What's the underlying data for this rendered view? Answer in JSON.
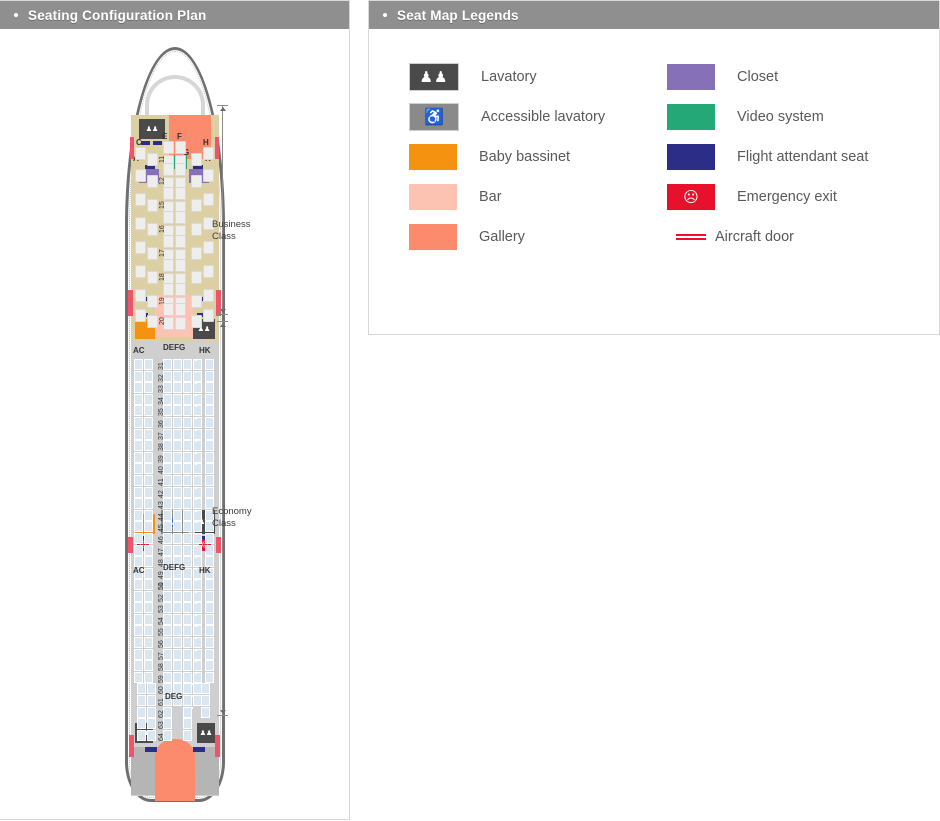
{
  "panels": {
    "left_title": "Seating Configuration Plan",
    "right_title": "Seat Map Legends"
  },
  "legend": {
    "left_column": [
      {
        "label": "Lavatory",
        "icon": "lavatory-icon",
        "color": "#4a4a4a",
        "glyph": "२"
      },
      {
        "label": "Accessible lavatory",
        "icon": "wheelchair-icon",
        "color": "#8a8a8a",
        "glyph": "♿"
      },
      {
        "label": "Baby bassinet",
        "icon": "bassinet-swatch",
        "color": "#f59311",
        "glyph": ""
      },
      {
        "label": "Bar",
        "icon": "bar-swatch",
        "color": "#fcc2b2",
        "glyph": ""
      },
      {
        "label": "Gallery",
        "icon": "gallery-swatch",
        "color": "#fc8b6d",
        "glyph": ""
      }
    ],
    "right_column": [
      {
        "label": "Closet",
        "icon": "closet-swatch",
        "color": "#8670b8",
        "glyph": ""
      },
      {
        "label": "Video system",
        "icon": "video-swatch",
        "color": "#25a877",
        "glyph": ""
      },
      {
        "label": "Flight attendant seat",
        "icon": "fa-seat-swatch",
        "color": "#2b2d86",
        "glyph": ""
      },
      {
        "label": "Emergency exit",
        "icon": "emergency-exit-icon",
        "color": "#e8112d",
        "glyph": "🏃"
      },
      {
        "label": "Aircraft door",
        "icon": "aircraft-door-icon",
        "color": "#e8112d",
        "glyph": ""
      }
    ]
  },
  "seatmap": {
    "classes": [
      {
        "name": "Business Class",
        "line1": "Business",
        "line2": "Class"
      },
      {
        "name": "Economy Class",
        "line1": "Economy",
        "line2": "Class"
      }
    ],
    "business": {
      "columns_left": [
        "C",
        "A"
      ],
      "columns_center": [
        "E",
        "F",
        "D",
        "G"
      ],
      "columns_right": [
        "H",
        "K"
      ],
      "rows": [
        "11",
        "12",
        "15",
        "16",
        "17",
        "18",
        "19",
        "20"
      ]
    },
    "economy_front": {
      "columns_left": "AC",
      "columns_center": "DEFG",
      "columns_right": "HK",
      "rows": [
        "31",
        "32",
        "33",
        "34",
        "35",
        "36",
        "37",
        "38",
        "39",
        "40",
        "41",
        "42",
        "43",
        "44",
        "45",
        "46",
        "47",
        "48",
        "49",
        "50"
      ]
    },
    "economy_rear": {
      "columns_left": "AC",
      "columns_center": "DEFG",
      "columns_right": "HK",
      "rows": [
        "51",
        "52",
        "53",
        "54",
        "55",
        "56",
        "57",
        "58",
        "59",
        "60",
        "61",
        "62",
        "63",
        "64"
      ],
      "tail_center_label": "DEG"
    },
    "icons": {
      "lavatory": "lavatory-icon",
      "accessible_lavatory": "accessible-lavatory-icon",
      "emergency_exit": "emergency-exit-icon",
      "aircraft_door": "aircraft-door-icon"
    }
  }
}
